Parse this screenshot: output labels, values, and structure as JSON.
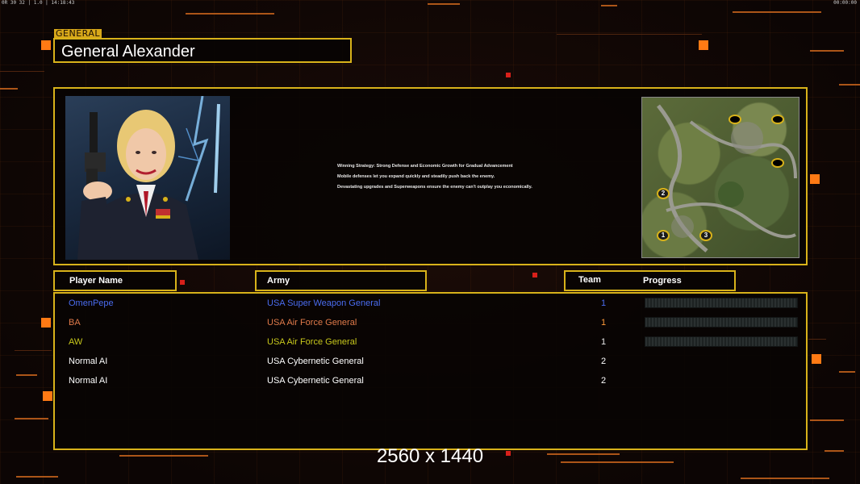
{
  "hud": {
    "top_left": "0R 30 32 | 1.0 | 14:18:43",
    "top_right": "00:00:00"
  },
  "section_tag": "GENERAL",
  "general_name": "General Alexander",
  "strategy": [
    "Winning Strategy: Strong Defense and Economic Growth for Gradual Advancement",
    "Mobile defenses let you expand quickly and steadily push back the enemy.",
    "Devastating upgrades and Superweapons ensure the enemy can't outplay you economically."
  ],
  "map": {
    "starts": [
      "1",
      "2",
      "3"
    ]
  },
  "columns": {
    "player": "Player Name",
    "army": "Army",
    "team": "Team",
    "progress": "Progress"
  },
  "players": [
    {
      "name": "OmenPepe",
      "army": "USA Super Weapon General",
      "team": "1",
      "color": "#4a6cf0",
      "team_color": "#4a6cf0",
      "progress": 0,
      "show_bar": true
    },
    {
      "name": "BA",
      "army": "USA Air Force General",
      "team": "1",
      "color": "#e07a4a",
      "team_color": "#ff9a3a",
      "progress": 0,
      "show_bar": true
    },
    {
      "name": "AW",
      "army": "USA Air Force General",
      "team": "1",
      "color": "#c8c81c",
      "team_color": "#e8e8e8",
      "progress": 0,
      "show_bar": true
    },
    {
      "name": "Normal AI",
      "army": "USA Cybernetic General",
      "team": "2",
      "color": "#ffffff",
      "team_color": "#ffffff",
      "progress": 0,
      "show_bar": false
    },
    {
      "name": "Normal AI",
      "army": "USA Cybernetic General",
      "team": "2",
      "color": "#ffffff",
      "team_color": "#ffffff",
      "progress": 0,
      "show_bar": false
    }
  ],
  "resolution_label": "2560 x 1440",
  "colors": {
    "accent": "#d8b21a",
    "highlight": "#ff7a14",
    "background": "#120806"
  }
}
